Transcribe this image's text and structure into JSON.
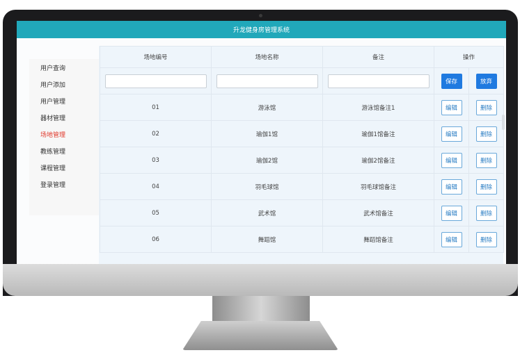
{
  "app": {
    "title": "升龙健身房管理系统"
  },
  "sidebar": {
    "items": [
      {
        "label": "用户查询",
        "active": false
      },
      {
        "label": "用户添加",
        "active": false
      },
      {
        "label": "用户管理",
        "active": false
      },
      {
        "label": "器材管理",
        "active": false
      },
      {
        "label": "场地管理",
        "active": true
      },
      {
        "label": "教练管理",
        "active": false
      },
      {
        "label": "课程管理",
        "active": false
      },
      {
        "label": "登录管理",
        "active": false
      }
    ]
  },
  "table": {
    "headers": [
      "场地编号",
      "场地名称",
      "备注",
      "操作"
    ],
    "input_row": {
      "id_value": "",
      "name_value": "",
      "note_value": "",
      "save_label": "保存",
      "discard_label": "放弃"
    },
    "rows": [
      {
        "id": "01",
        "name": "游泳馆",
        "note": "游泳馆备注1",
        "edit": "编辑",
        "delete": "删除"
      },
      {
        "id": "02",
        "name": "瑜伽1馆",
        "note": "瑜伽1馆备注",
        "edit": "编辑",
        "delete": "删除"
      },
      {
        "id": "03",
        "name": "瑜伽2馆",
        "note": "瑜伽2馆备注",
        "edit": "编辑",
        "delete": "删除"
      },
      {
        "id": "04",
        "name": "羽毛球馆",
        "note": "羽毛球馆备注",
        "edit": "编辑",
        "delete": "删除"
      },
      {
        "id": "05",
        "name": "武术馆",
        "note": "武术馆备注",
        "edit": "编辑",
        "delete": "删除"
      },
      {
        "id": "06",
        "name": "舞蹈馆",
        "note": "舞蹈馆备注",
        "edit": "编辑",
        "delete": "删除"
      }
    ]
  },
  "colors": {
    "topbar": "#21a8ba",
    "active_menu": "#e0392b",
    "primary_button": "#1f7ae0",
    "content_bg": "#eef5fb"
  }
}
